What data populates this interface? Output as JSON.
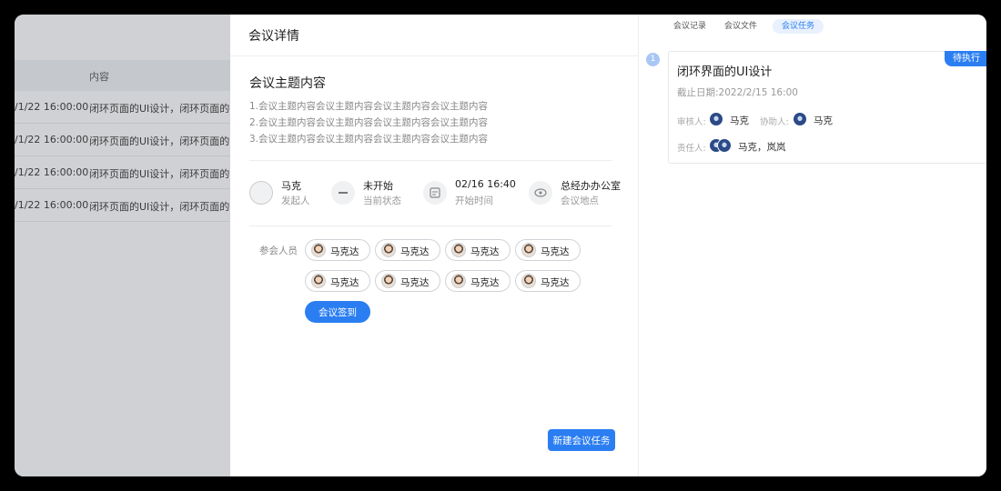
{
  "bg_table": {
    "header_content": "内容",
    "rows": [
      {
        "time": "/1/22 16:00:00",
        "content": "闭环页面的UI设计，闭环页面的UI设计"
      },
      {
        "time": "/1/22 16:00:00",
        "content": "闭环页面的UI设计，闭环页面的UI设计"
      },
      {
        "time": "/1/22 16:00:00",
        "content": "闭环页面的UI设计，闭环页面的UI设计"
      },
      {
        "time": "/1/22 16:00:00",
        "content": "闭环页面的UI设计，闭环页面的UI设计"
      }
    ]
  },
  "detail": {
    "header_title": "会议详情",
    "topic_title": "会议主题内容",
    "topic_lines": [
      "1.会议主题内容会议主题内容会议主题内容会议主题内容",
      "2.会议主题内容会议主题内容会议主题内容会议主题内容",
      "3.会议主题内容会议主题内容会议主题内容会议主题内容"
    ],
    "info": [
      {
        "icon": "avatar",
        "value": "马克",
        "label": "发起人"
      },
      {
        "icon": "minus-icon",
        "value": "未开始",
        "label": "当前状态"
      },
      {
        "icon": "calendar-icon",
        "value": "02/16 16:40",
        "label": "开始时间"
      },
      {
        "icon": "eye-icon",
        "value": "总经办办公室",
        "label": "会议地点"
      }
    ],
    "attendees_label": "参会人员",
    "attendees": [
      "马克达",
      "马克达",
      "马克达",
      "马克达",
      "马克达",
      "马克达",
      "马克达",
      "马克达"
    ],
    "checkin_button": "会议签到",
    "new_task_button": "新建会议任务"
  },
  "right_panel": {
    "tabs": [
      {
        "label": "会议记录",
        "active": false
      },
      {
        "label": "会议文件",
        "active": false
      },
      {
        "label": "会议任务",
        "active": true
      }
    ],
    "task": {
      "number": "1",
      "title": "闭环界面的UI设计",
      "deadline": "截止日期:2022/2/15 16:00",
      "status": "待执行",
      "reviewer_label": "审核人:",
      "reviewer": "马克",
      "assistant_label": "协助人:",
      "assistant": "马克",
      "owner_label": "责任人:",
      "owners": "马克，岚岚"
    }
  },
  "colors": {
    "accent": "#2b7ef2",
    "overlay": "#cfd1d4"
  }
}
